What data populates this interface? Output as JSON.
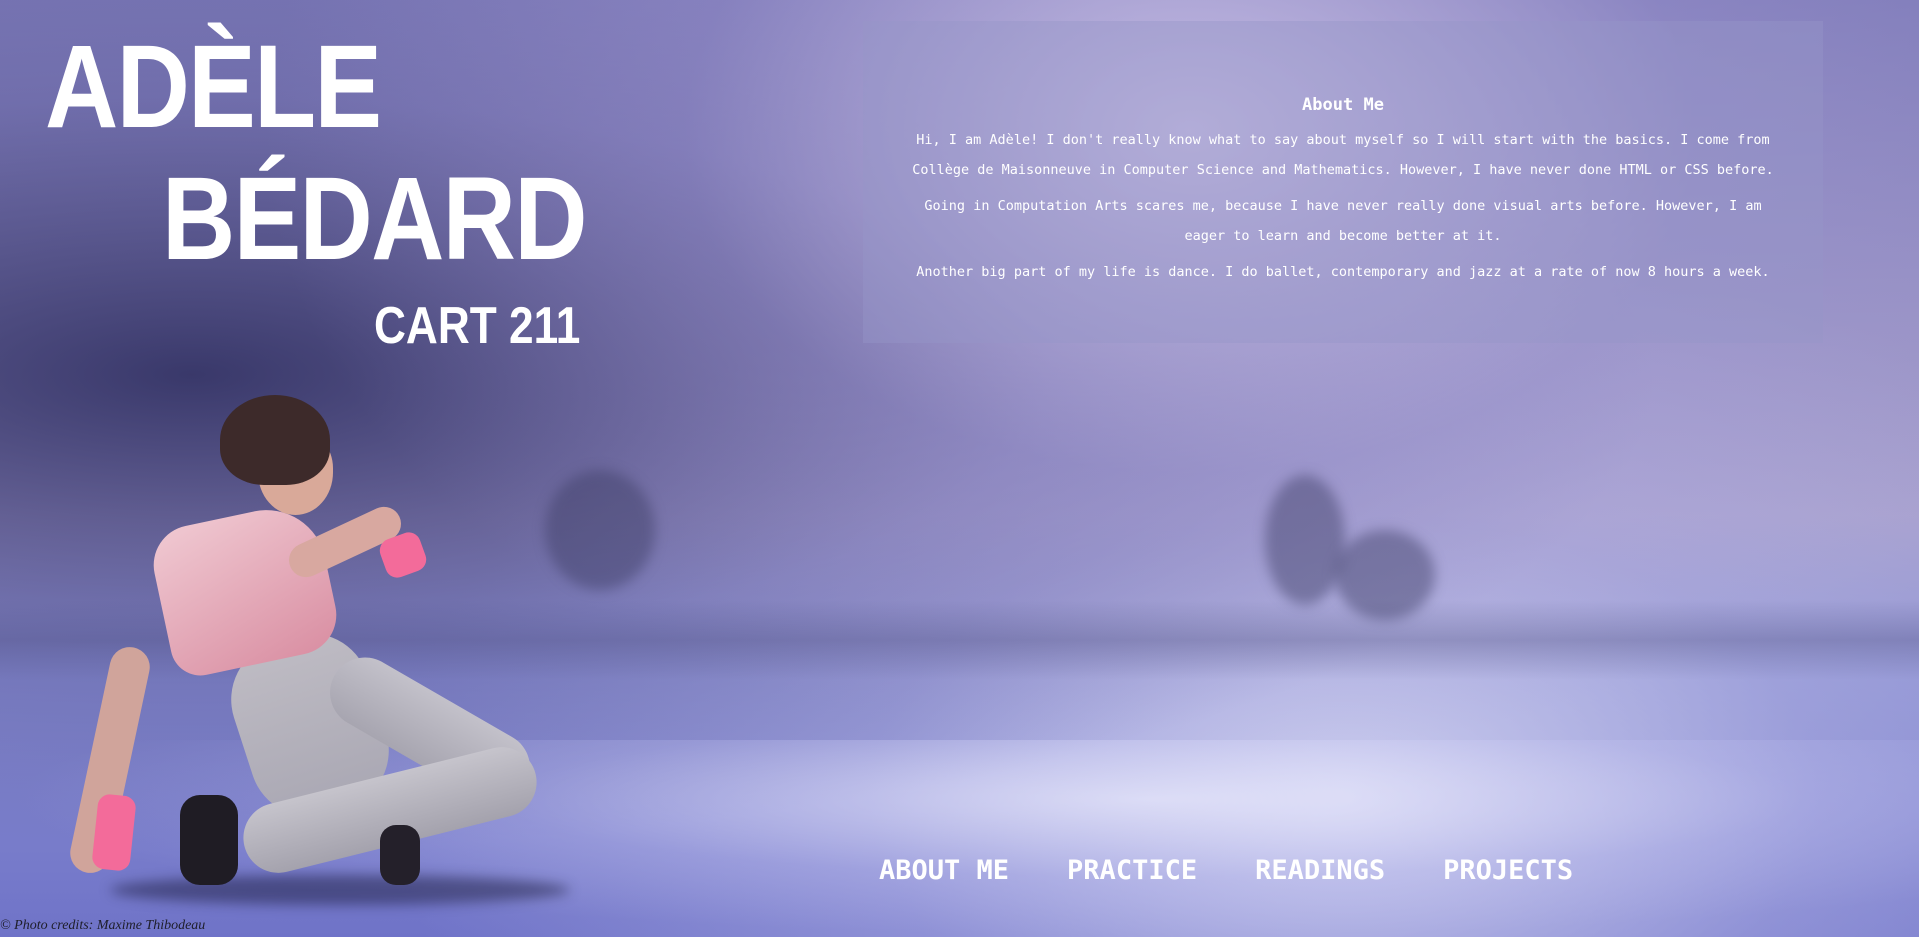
{
  "header": {
    "first_name": "ADÈLE",
    "last_name": "BÉDARD",
    "course": "CART 211"
  },
  "about": {
    "title": "About Me",
    "paragraphs": [
      "Hi, I am Adèle! I don't really know what to say about myself so I will start with the basics. I come from Collège de Maisonneuve in Computer Science and Mathematics. However, I have never done HTML or CSS before.",
      "Going in Computation Arts scares me, because I have never really done visual arts before. However, I am eager to learn and become better at it.",
      "Another big part of my life is dance. I do ballet, contemporary and jazz at a rate of now 8 hours a week."
    ]
  },
  "nav": {
    "items": [
      {
        "label": "ABOUT ME"
      },
      {
        "label": "PRACTICE"
      },
      {
        "label": "READINGS"
      },
      {
        "label": "PROJECTS"
      }
    ]
  },
  "footer": {
    "credits": "© Photo credits: Maxime Thibodeau"
  }
}
